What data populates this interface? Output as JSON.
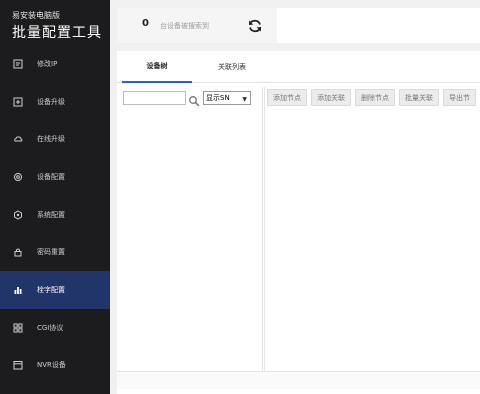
{
  "app": {
    "subtitle": "易安装电脑版",
    "title": "批量配置工具"
  },
  "sidebar": {
    "items": [
      {
        "label": "修改IP",
        "icon": "edit-icon",
        "active": false
      },
      {
        "label": "设备升级",
        "icon": "upgrade-icon",
        "active": false
      },
      {
        "label": "在线升级",
        "icon": "cloud-icon",
        "active": false
      },
      {
        "label": "设备配置",
        "icon": "settings-icon",
        "active": false
      },
      {
        "label": "系统配置",
        "icon": "system-icon",
        "active": false
      },
      {
        "label": "密码重置",
        "icon": "lock-icon",
        "active": false
      },
      {
        "label": "栓字配置",
        "icon": "bar-chart-icon",
        "active": true
      },
      {
        "label": "CGI协议",
        "icon": "grid-icon",
        "active": false
      },
      {
        "label": "NVR设备",
        "icon": "calendar-icon",
        "active": false
      }
    ]
  },
  "topbar": {
    "count": "0",
    "status_text": "台设备被搜索到"
  },
  "tabs": [
    {
      "label": "设备树",
      "active": true
    },
    {
      "label": "关联列表",
      "active": false
    }
  ],
  "tree_panel": {
    "search_value": "",
    "select_value": "显示SN"
  },
  "toolbar": {
    "buttons": [
      "添加节点",
      "添加关联",
      "删除节点",
      "批量关联",
      "导出节"
    ]
  },
  "colors": {
    "sidebar_bg": "#1c1c1e",
    "active_item": "#22356b",
    "accent": "#2f5bd6"
  }
}
